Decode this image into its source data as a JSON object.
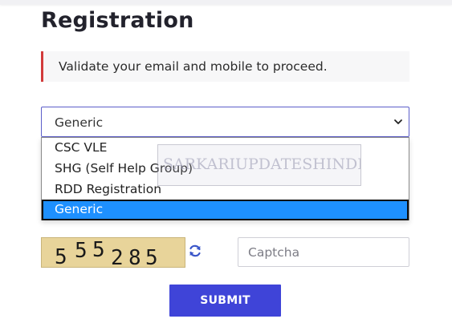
{
  "page": {
    "title": "Registration"
  },
  "notice": {
    "text": "Validate your email and mobile to proceed."
  },
  "user_type_select": {
    "selected": "Generic",
    "options": [
      "CSC VLE",
      "SHG (Self Help Group)",
      "RDD Registration",
      "Generic"
    ],
    "highlighted_option": "Generic"
  },
  "watermark": {
    "text": "SARKARIUPDATESHINDI.COM"
  },
  "captcha": {
    "image_text": "555285",
    "input_placeholder": "Captcha",
    "refresh_icon": "refresh-icon"
  },
  "submit": {
    "label": "SUBMIT"
  },
  "colors": {
    "accent": "#3f44d8",
    "notice_border": "#d23b3b",
    "option_highlight": "#1e90ff",
    "captcha_bg": "#e8d49a"
  }
}
